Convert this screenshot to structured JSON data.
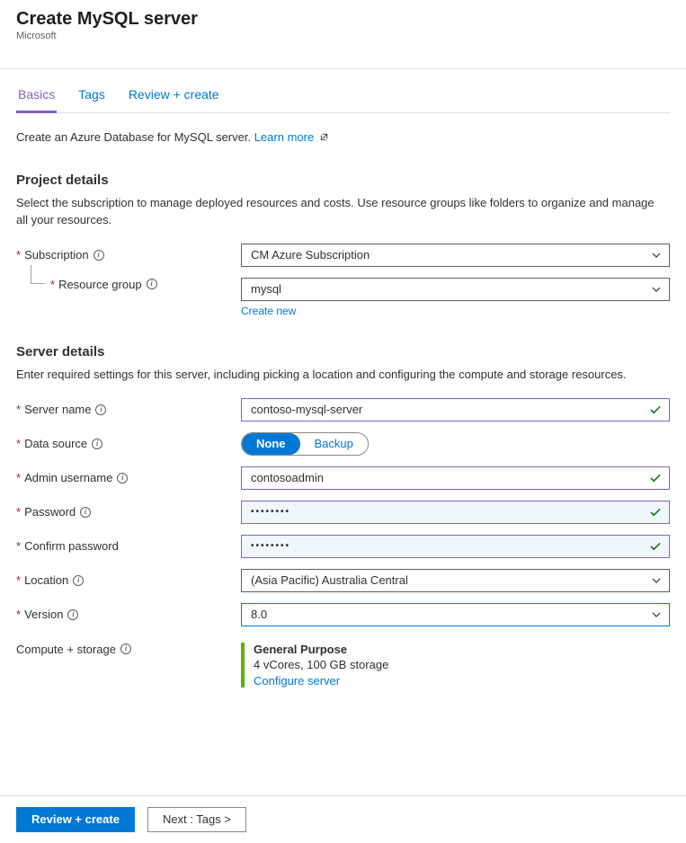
{
  "header": {
    "title": "Create MySQL server",
    "subtitle": "Microsoft"
  },
  "tabs": {
    "basics": "Basics",
    "tags": "Tags",
    "review": "Review + create"
  },
  "intro": {
    "text": "Create an Azure Database for MySQL server. ",
    "link": "Learn more"
  },
  "project": {
    "heading": "Project details",
    "desc": "Select the subscription to manage deployed resources and costs. Use resource groups like folders to organize and manage all your resources.",
    "subscription_label": "Subscription",
    "subscription_value": "CM Azure Subscription",
    "resource_group_label": "Resource group",
    "resource_group_value": "mysql",
    "create_new": "Create new"
  },
  "server": {
    "heading": "Server details",
    "desc": "Enter required settings for this server, including picking a location and configuring the compute and storage resources.",
    "server_name_label": "Server name",
    "server_name_value": "contoso-mysql-server",
    "data_source_label": "Data source",
    "data_source_options": {
      "none": "None",
      "backup": "Backup"
    },
    "admin_username_label": "Admin username",
    "admin_username_value": "contosoadmin",
    "password_label": "Password",
    "password_value": "••••••••",
    "confirm_password_label": "Confirm password",
    "confirm_password_value": "••••••••",
    "location_label": "Location",
    "location_value": "(Asia Pacific) Australia Central",
    "version_label": "Version",
    "version_value": "8.0",
    "compute_storage_label": "Compute + storage",
    "compute_title": "General Purpose",
    "compute_desc": "4 vCores, 100 GB storage",
    "configure_link": "Configure server"
  },
  "footer": {
    "review": "Review + create",
    "next": "Next : Tags >"
  }
}
